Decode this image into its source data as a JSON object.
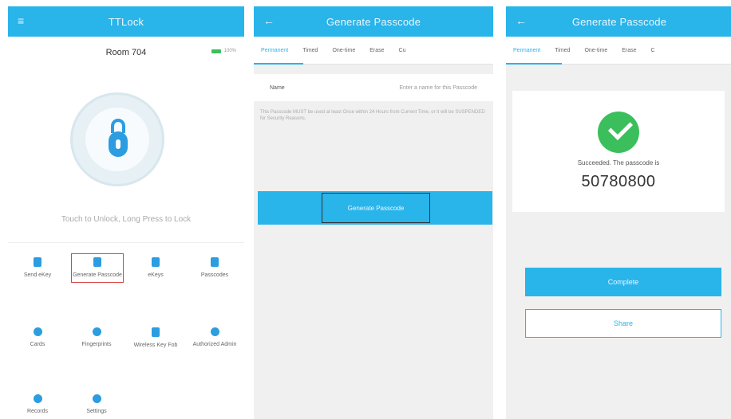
{
  "panel1": {
    "app_title": "TTLock",
    "menu_icon": "menu-icon",
    "room": "Room 704",
    "battery": "100%",
    "hint": "Touch to Unlock, Long Press to Lock",
    "grid": [
      {
        "label": "Send eKey",
        "icon": "send-ekey-icon"
      },
      {
        "label": "Generate Passcode",
        "icon": "passcode-icon"
      },
      {
        "label": "eKeys",
        "icon": "ekeys-icon"
      },
      {
        "label": "Passcodes",
        "icon": "passcodes-icon"
      },
      {
        "label": "Cards",
        "icon": "cards-icon"
      },
      {
        "label": "Fingerprints",
        "icon": "fingerprint-icon"
      },
      {
        "label": "Wireless Key Fob",
        "icon": "key-fob-icon"
      },
      {
        "label": "Authorized Admin",
        "icon": "admin-icon"
      },
      {
        "label": "Records",
        "icon": "records-icon"
      },
      {
        "label": "Settings",
        "icon": "settings-icon"
      }
    ]
  },
  "panel2": {
    "title": "Generate Passcode",
    "tabs": [
      "Permanent",
      "Timed",
      "One-time",
      "Erase",
      "Cu"
    ],
    "name_label": "Name",
    "name_placeholder": "Enter a name for this Passcode",
    "note": "This Passcode MUST be used at least Once within 24 Hours from Current Time, or it will be SUSPENDED for Security Reasons.",
    "button": "Generate Passcode"
  },
  "panel3": {
    "title": "Generate Passcode",
    "tabs": [
      "Permanent",
      "Timed",
      "One-time",
      "Erase",
      "C"
    ],
    "success_text": "Succeeded. The passcode is",
    "code": "50780800",
    "complete": "Complete",
    "share": "Share"
  },
  "colors": {
    "accent": "#29b4ea",
    "success": "#3bbf5c",
    "highlight": "#d94545"
  }
}
